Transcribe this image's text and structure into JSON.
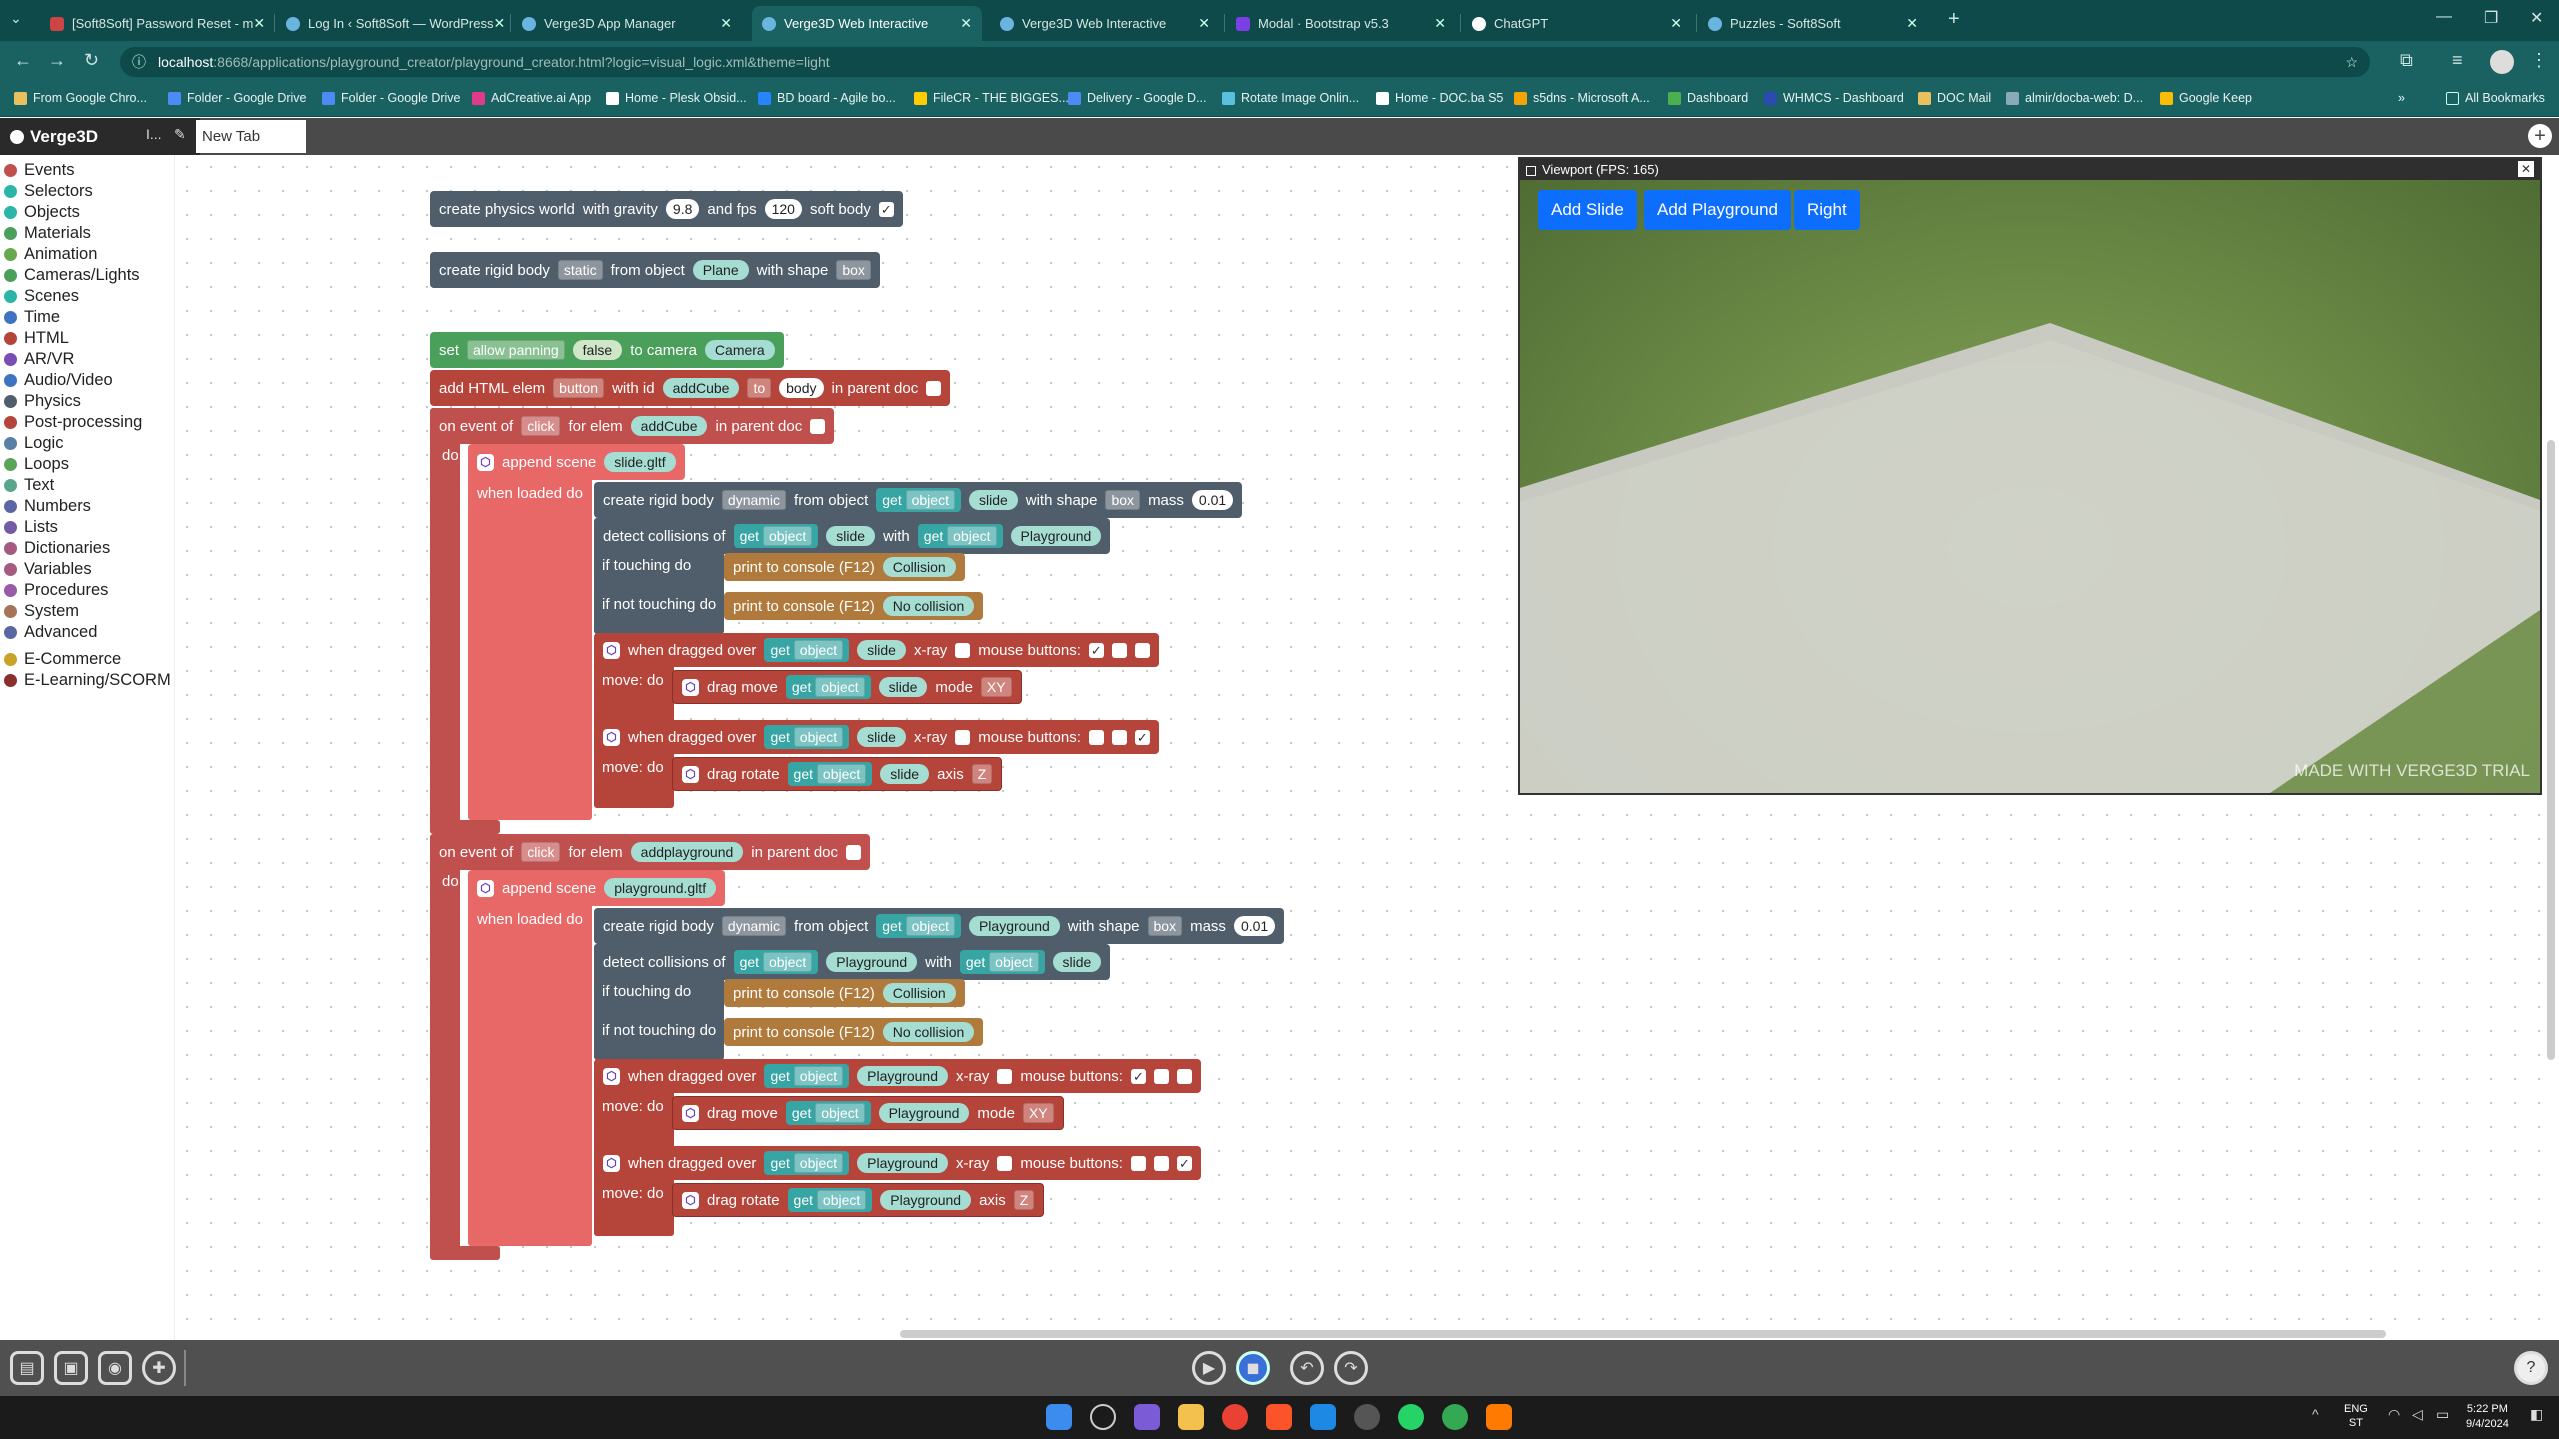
{
  "browser": {
    "tabs": [
      {
        "title": "[Soft8Soft] Password Reset - m",
        "active": false
      },
      {
        "title": "Log In ‹ Soft8Soft — WordPress",
        "active": false
      },
      {
        "title": "Verge3D App Manager",
        "active": false
      },
      {
        "title": "Verge3D Web Interactive",
        "active": true
      },
      {
        "title": "Verge3D Web Interactive",
        "active": false
      },
      {
        "title": "Modal · Bootstrap v5.3",
        "active": false
      },
      {
        "title": "ChatGPT",
        "active": false
      },
      {
        "title": "Puzzles - Soft8Soft",
        "active": false
      }
    ],
    "url_host": "localhost",
    "url_path": ":8668/applications/playground_creator/playground_creator.html?logic=visual_logic.xml&theme=light",
    "bookmarks": [
      "From Google Chro...",
      "Folder - Google Drive",
      "Folder - Google Drive",
      "AdCreative.ai App",
      "Home - Plesk Obsid...",
      "BD board - Agile bo...",
      "FileCR - THE BIGGES...",
      "Delivery - Google D...",
      "Rotate Image Onlin...",
      "Home - DOC.ba S5",
      "s5dns - Microsoft A...",
      "Dashboard",
      "WHMCS - Dashboard",
      "DOC Mail",
      "almir/docba-web: D...",
      "Google Keep"
    ],
    "all_bookmarks": "All Bookmarks"
  },
  "app": {
    "brand": "Verge3D",
    "new_tab": "New Tab",
    "tab_icon": "I..."
  },
  "toolbox": {
    "categories": [
      {
        "label": "Events",
        "color": "#c0504d"
      },
      {
        "label": "Selectors",
        "color": "#2bb5a8"
      },
      {
        "label": "Objects",
        "color": "#2bb5a8"
      },
      {
        "label": "Materials",
        "color": "#4aa05a"
      },
      {
        "label": "Animation",
        "color": "#6aa84f"
      },
      {
        "label": "Cameras/Lights",
        "color": "#4aa05a"
      },
      {
        "label": "Scenes",
        "color": "#2bb5a8"
      },
      {
        "label": "Time",
        "color": "#3d73c0"
      },
      {
        "label": "HTML",
        "color": "#b5443a"
      },
      {
        "label": "AR/VR",
        "color": "#7a4db5"
      },
      {
        "label": "Audio/Video",
        "color": "#3d73c0"
      },
      {
        "label": "Physics",
        "color": "#505e6c"
      },
      {
        "label": "Post-processing",
        "color": "#b5443a"
      },
      {
        "label": "Logic",
        "color": "#5b80a5"
      },
      {
        "label": "Loops",
        "color": "#5ba55b"
      },
      {
        "label": "Text",
        "color": "#5ba58c"
      },
      {
        "label": "Numbers",
        "color": "#5b67a5"
      },
      {
        "label": "Lists",
        "color": "#745ba5"
      },
      {
        "label": "Dictionaries",
        "color": "#a55b80"
      },
      {
        "label": "Variables",
        "color": "#a55b80"
      },
      {
        "label": "Procedures",
        "color": "#995ba5"
      },
      {
        "label": "System",
        "color": "#a5745b"
      },
      {
        "label": "Advanced",
        "color": "#5b67a5"
      },
      {
        "label": "E-Commerce",
        "color": "#c9a227"
      },
      {
        "label": "E-Learning/SCORM",
        "color": "#8b2e2e"
      }
    ]
  },
  "blocks": {
    "physics_world": {
      "label": "create physics world",
      "gravity_label": "with gravity",
      "gravity": "9.8",
      "fps_label": "and fps",
      "fps": "120",
      "softbody_label": "soft body",
      "softbody": "✓"
    },
    "rigid_plane": {
      "label": "create rigid body",
      "type": "static",
      "from": "from object",
      "object": "Plane",
      "shape_label": "with shape",
      "shape": "box"
    },
    "set_panning": {
      "set": "set",
      "prop": "allow panning",
      "value": "false",
      "to_camera": "to camera",
      "camera": "Camera"
    },
    "add_html": {
      "label": "add HTML elem",
      "elem": "button",
      "with_id": "with id",
      "id": "addCube",
      "to": "to",
      "parent": "body",
      "in_parent": "in parent doc"
    },
    "event1": {
      "label": "on event of",
      "event": "click",
      "for_elem": "for elem",
      "elem": "addCube",
      "in_parent": "in parent doc",
      "do": "do",
      "append": "append scene",
      "scene": "slide.gltf",
      "when_loaded": "when loaded do",
      "rigid": {
        "label": "create rigid body",
        "type": "dynamic",
        "from": "from object",
        "get": "get",
        "obj": "object",
        "name": "slide",
        "shape_label": "with shape",
        "shape": "box",
        "mass_label": "mass",
        "mass": "0.01"
      },
      "collide": {
        "label": "detect collisions of",
        "a": "slide",
        "with": "with",
        "b": "Playground",
        "touching": "if touching do",
        "not_touching": "if not touching do",
        "print": "print to console (F12)",
        "msg1": "Collision",
        "msg2": "No collision"
      },
      "drag1": {
        "label": "when dragged over",
        "name": "slide",
        "xray": "x-ray",
        "buttons": "mouse buttons:",
        "move_do": "move: do",
        "action": "drag move",
        "mode_label": "mode",
        "mode": "XY"
      },
      "drag2": {
        "label": "when dragged over",
        "name": "slide",
        "xray": "x-ray",
        "buttons": "mouse buttons:",
        "move_do": "move: do",
        "action": "drag rotate",
        "mode_label": "axis",
        "mode": "Z"
      }
    },
    "event2": {
      "label": "on event of",
      "event": "click",
      "for_elem": "for elem",
      "elem": "addplayground",
      "in_parent": "in parent doc",
      "do": "do",
      "append": "append scene",
      "scene": "playground.gltf",
      "when_loaded": "when loaded do",
      "rigid": {
        "label": "create rigid body",
        "type": "dynamic",
        "from": "from object",
        "get": "get",
        "obj": "object",
        "name": "Playground",
        "shape_label": "with shape",
        "shape": "box",
        "mass_label": "mass",
        "mass": "0.01"
      },
      "collide": {
        "label": "detect collisions of",
        "a": "Playground",
        "with": "with",
        "b": "slide",
        "touching": "if touching do",
        "not_touching": "if not touching do",
        "print": "print to console (F12)",
        "msg1": "Collision",
        "msg2": "No collision"
      },
      "drag1": {
        "label": "when dragged over",
        "name": "Playground",
        "xray": "x-ray",
        "buttons": "mouse buttons:",
        "move_do": "move: do",
        "action": "drag move",
        "mode_label": "mode",
        "mode": "XY"
      },
      "drag2": {
        "label": "when dragged over",
        "name": "Playground",
        "xray": "x-ray",
        "buttons": "mouse buttons:",
        "move_do": "move: do",
        "action": "drag rotate",
        "mode_label": "axis",
        "mode": "Z"
      }
    }
  },
  "viewport": {
    "title": "Viewport (FPS: 165)",
    "buttons": [
      "Add Slide",
      "Add Playground",
      "Right"
    ],
    "watermark": "MADE WITH VERGE3D TRIAL"
  },
  "taskbar": {
    "lang1": "ENG",
    "lang2": "ST",
    "time": "5:22 PM",
    "date": "9/4/2024"
  },
  "colors": {
    "events": "#c0504d",
    "physics": "#505e6c",
    "scene": "#2bb5a8",
    "html": "#b5443a",
    "accent": "#0d6efd"
  }
}
